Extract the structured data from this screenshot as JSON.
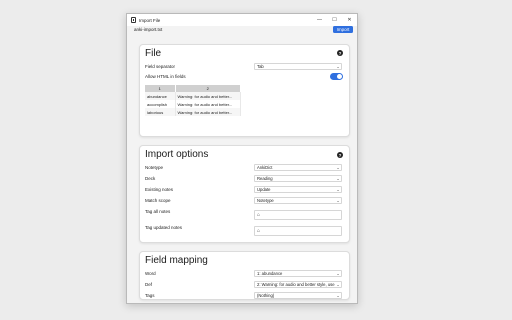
{
  "window": {
    "title": "Import File",
    "controls": {
      "minimize": "—",
      "maximize": "☐",
      "close": "✕"
    }
  },
  "toolbar": {
    "filename": "anki-import.txt",
    "import_label": "Import"
  },
  "file_section": {
    "title": "File",
    "help": "?",
    "field_separator": {
      "label": "Field separator",
      "value": "Tab"
    },
    "allow_html": {
      "label": "Allow HTML in fields",
      "on": true
    },
    "preview": {
      "columns": [
        "1",
        "2"
      ],
      "rows": [
        [
          "abundance",
          "Warning: for audio and better..."
        ],
        [
          "accomplish",
          "Warning: for audio and better..."
        ],
        [
          "laborious",
          "Warning: for audio and better..."
        ]
      ]
    }
  },
  "import_section": {
    "title": "Import options",
    "help": "?",
    "notetype": {
      "label": "Notetype",
      "value": "AnkiDict"
    },
    "deck": {
      "label": "Deck",
      "value": "Reading"
    },
    "existing_notes": {
      "label": "Existing notes",
      "value": "Update"
    },
    "match_scope": {
      "label": "Match scope",
      "value": "Notetype"
    },
    "tag_all": {
      "label": "Tag all notes",
      "icon": "tag-icon"
    },
    "tag_updated": {
      "label": "Tag updated notes",
      "icon": "tag-icon"
    }
  },
  "mapping_section": {
    "title": "Field mapping",
    "word": {
      "label": "Word",
      "value": "1: abundance"
    },
    "def": {
      "label": "Def",
      "value": "2: Warning: for audio and better style, use..."
    },
    "tags": {
      "label": "Tags",
      "value": "(Nothing)"
    }
  },
  "colors": {
    "accent": "#2f6fdf",
    "background": "#ececec",
    "card": "#ffffff"
  }
}
